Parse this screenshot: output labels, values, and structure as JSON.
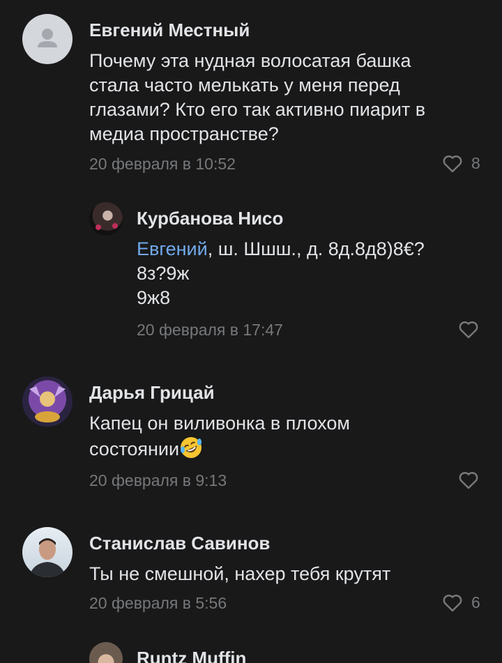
{
  "comments": [
    {
      "name": "Евгений Местный",
      "lines": [
        "Почему эта нудная волосатая башка",
        "стала часто мелькать у меня перед",
        "глазами? Кто его так активно пиарит в",
        "медиа пространстве?"
      ],
      "date": "20 февраля в 10:52",
      "likes": "8",
      "avatar_icon": "default-user-icon"
    },
    {
      "name": "Курбанова Нисо",
      "mention": "Евгений",
      "line1_rest": ", ш. Шшш., д. 8д.8д8)8€?",
      "line2": "8з?9ж",
      "line3": "9ж8",
      "date": "20 февраля в 17:47"
    },
    {
      "name": "Дарья Грицай",
      "line1": "Капец он виливонка в плохом",
      "line2": "состоянии",
      "date": "20 февраля в 9:13"
    },
    {
      "name": "Станислав Савинов",
      "line1": "Ты не смешной, нахер тебя крутят",
      "date": "20 февраля в 5:56",
      "likes": "6"
    },
    {
      "name": "Runtz Muffin"
    }
  ],
  "colors": {
    "background": "#19191a",
    "text": "#e1e3e6",
    "secondary": "#76787a",
    "link": "#71aaeb"
  }
}
